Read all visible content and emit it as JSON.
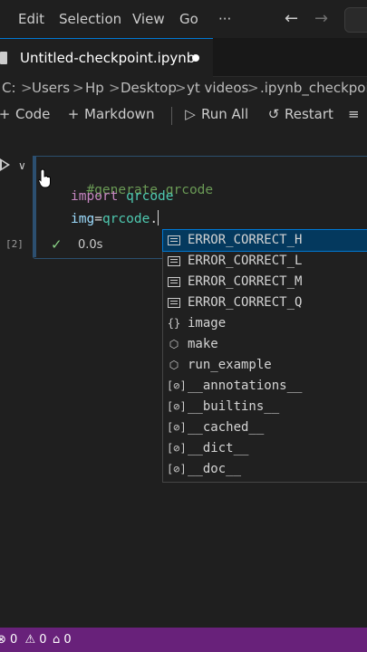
{
  "menu": {
    "edit": "Edit",
    "selection": "Selection",
    "view": "View",
    "go": "Go",
    "more": "···"
  },
  "tab": {
    "title": "Untitled-checkpoint.ipynb"
  },
  "breadcrumb": [
    "C:",
    "Users",
    "Hp",
    "Desktop",
    "yt videos",
    ".ipynb_checkpoints"
  ],
  "toolbar": {
    "code": "Code",
    "markdown": "Markdown",
    "run_all": "Run All",
    "restart": "Restart"
  },
  "cell": {
    "exec_count": "[2]",
    "exec_time": "0.0s",
    "lines": {
      "comment": "#generate qrcode",
      "import_kw": "import",
      "import_mod": "qrcode",
      "assign_var": "img",
      "assign_eq": "=",
      "assign_mod": "qrcode",
      "assign_dot": "."
    }
  },
  "suggestions": [
    {
      "label": "ERROR_CORRECT_H",
      "icon": "enum-icon",
      "selected": true
    },
    {
      "label": "ERROR_CORRECT_L",
      "icon": "enum-icon"
    },
    {
      "label": "ERROR_CORRECT_M",
      "icon": "enum-icon"
    },
    {
      "label": "ERROR_CORRECT_Q",
      "icon": "enum-icon"
    },
    {
      "label": "image",
      "icon": "module-icon"
    },
    {
      "label": "make",
      "icon": "method-icon"
    },
    {
      "label": "run_example",
      "icon": "method-icon"
    },
    {
      "label": "__annotations__",
      "icon": "variable-icon"
    },
    {
      "label": "__builtins__",
      "icon": "variable-icon"
    },
    {
      "label": "__cached__",
      "icon": "variable-icon"
    },
    {
      "label": "__dict__",
      "icon": "variable-icon"
    },
    {
      "label": "__doc__",
      "icon": "variable-icon"
    }
  ],
  "status": {
    "errors": "0",
    "warnings": "0",
    "ports": "0"
  },
  "colors": {
    "status_bar": "#68217a",
    "selection": "#04395e",
    "accent": "#0078d4"
  }
}
